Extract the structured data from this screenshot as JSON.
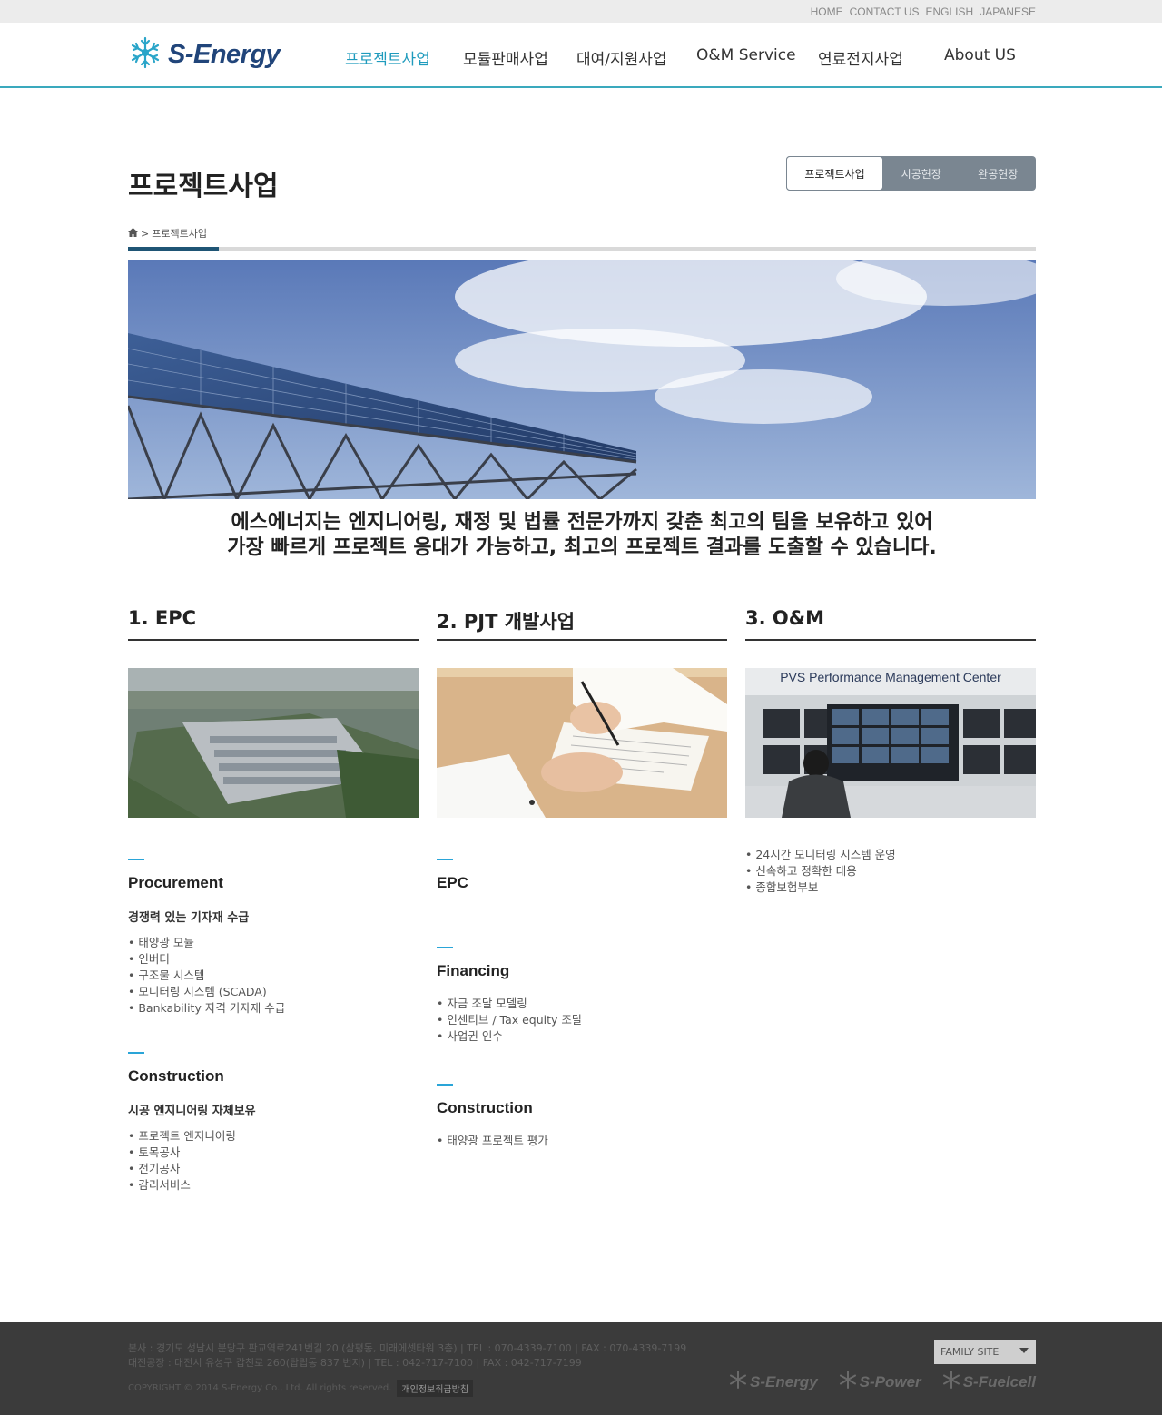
{
  "top_links": [
    "HOME",
    "CONTACT US",
    "ENGLISH",
    "JAPANESE"
  ],
  "logo": {
    "text": "S-Energy"
  },
  "nav": [
    {
      "label": "프로젝트사업",
      "active": true
    },
    {
      "label": "모듈판매사업",
      "active": false
    },
    {
      "label": "대여/지원사업",
      "active": false
    },
    {
      "label": "O&M Service",
      "active": false
    },
    {
      "label": "연료전지사업",
      "active": false
    },
    {
      "label": "About US",
      "active": false
    }
  ],
  "page_title": "프로젝트사업",
  "subtabs": [
    {
      "label": "프로젝트사업",
      "active": true
    },
    {
      "label": "시공현장",
      "active": false
    },
    {
      "label": "완공현장",
      "active": false
    }
  ],
  "breadcrumb": {
    "separator": ">",
    "current": "프로젝트사업"
  },
  "intro": {
    "line1": "에스에너지는 엔지니어링, 재정 및 법률 전문가까지 갖춘 최고의 팀을 보유하고 있어",
    "line2": "가장 빠르게 프로젝트 응대가 가능하고, 최고의 프로젝트 결과를 도출할 수 있습니다."
  },
  "columns": [
    {
      "title": "1. EPC",
      "sections": [
        {
          "title": "Procurement",
          "subtitle": "경쟁력 있는 기자재 수급",
          "items": [
            "태양광 모듈",
            "인버터",
            "구조물 시스템",
            "모니터링 시스템 (SCADA)",
            "Bankability 자격 기자재 수급"
          ]
        },
        {
          "title": "Construction",
          "subtitle": "시공 엔지니어링 자체보유",
          "items": [
            "프로젝트 엔지니어링",
            "토목공사",
            "전기공사",
            "감리서비스"
          ]
        }
      ]
    },
    {
      "title": "2. PJT 개발사업",
      "sections": [
        {
          "title": "EPC",
          "subtitle": "",
          "items": []
        },
        {
          "title": "Financing",
          "subtitle": "",
          "items": [
            "자금 조달 모델링",
            "인센티브 / Tax equity 조달",
            "사업권 인수"
          ]
        },
        {
          "title": "Construction",
          "subtitle": "",
          "items": [
            "태양광 프로젝트 평가"
          ]
        }
      ]
    },
    {
      "title": "3. O&M",
      "image_caption": "PVS Performance Management Center",
      "items": [
        "24시간 모니터링 시스템 운영",
        "신속하고 정확한 대응",
        "종합보험부보"
      ]
    }
  ],
  "footer": {
    "line1": "본사 : 경기도 성남시 분당구 판교역로241번길 20 (삼평동, 미래에셋타워 3층) | TEL : 070-4339-7100 | FAX : 070-4339-7199",
    "line2": "대전공장 : 대전시 유성구 갑천로 260(탑립동 837 번지) | TEL : 042-717-7100 | FAX : 042-717-7199",
    "copyright": "COPYRIGHT © 2014 S-Energy Co., Ltd. All rights reserved.",
    "privacy": "개인정보취급방침",
    "family_site": "FAMILY SITE",
    "brands": [
      "S-Energy",
      "S-Power",
      "S-Fuelcell"
    ]
  },
  "colors": {
    "accent": "#1f9bbd",
    "header_line": "#3aa9bd",
    "logo": "#21457a",
    "footer_bg": "#3b3b3b"
  }
}
